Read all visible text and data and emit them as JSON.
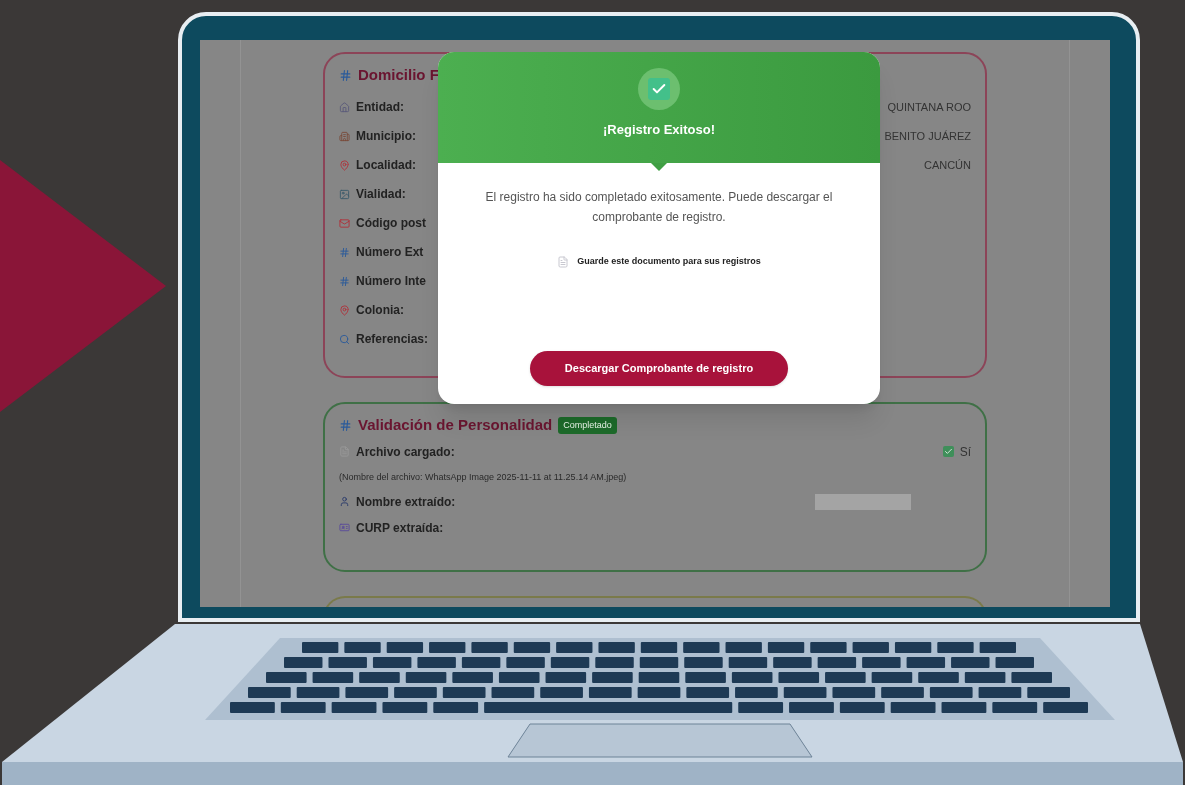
{
  "address_card": {
    "title": "Domicilio F",
    "fields": [
      {
        "label": "Entidad:",
        "value": "QUINTANA ROO"
      },
      {
        "label": "Municipio:",
        "value": "BENITO JUÁREZ"
      },
      {
        "label": "Localidad:",
        "value": "CANCÚN"
      },
      {
        "label": "Vialidad:"
      },
      {
        "label": "Código post"
      },
      {
        "label": "Número Ext"
      },
      {
        "label": "Número Inte"
      },
      {
        "label": "Colonia:"
      },
      {
        "label": "Referencias:"
      }
    ]
  },
  "validation_card": {
    "title": "Validación de Personalidad",
    "badge": "Completado",
    "file_row": {
      "label": "Archivo cargado:",
      "checked": true,
      "value": "Sí"
    },
    "file_note": "(Nombre del archivo: WhatsApp Image 2025-11-11 at 11.25.14 AM.jpeg)",
    "fields": [
      {
        "label": "Nombre extraído:",
        "redacted": true
      },
      {
        "label": "CURP extraída:",
        "redacted": false
      }
    ]
  },
  "modal": {
    "title": "¡Registro Exitoso!",
    "message": "El registro ha sido completado exitosamente. Puede descargar el comprobante de registro.",
    "note": "Guarde este documento para sus registros",
    "button": "Descargar Comprobante de registro"
  }
}
